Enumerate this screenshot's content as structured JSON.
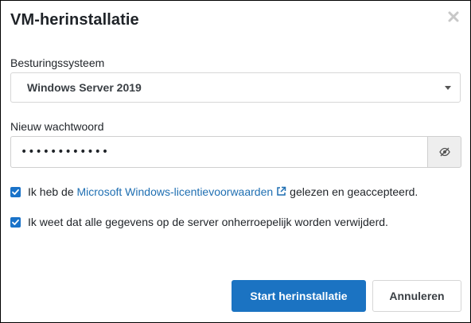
{
  "dialog": {
    "title": "VM-herinstallatie",
    "close_icon": "close-icon"
  },
  "os_field": {
    "label": "Besturingssysteem",
    "selected": "Windows Server 2019",
    "caret_icon": "caret-down-icon"
  },
  "password_field": {
    "label": "Nieuw wachtwoord",
    "value": "••••••••••••",
    "toggle_icon": "eye-slash-icon"
  },
  "checkboxes": [
    {
      "checked": true,
      "text_before": "Ik heb de ",
      "link_text": "Microsoft Windows-licentievoorwaarden",
      "link_icon": "external-link-icon",
      "text_after": "gelezen en geaccepteerd."
    },
    {
      "checked": true,
      "text": "Ik weet dat alle gegevens op de server onherroepelijk worden verwijderd."
    }
  ],
  "buttons": {
    "primary": "Start herinstallatie",
    "secondary": "Annuleren"
  },
  "colors": {
    "primary": "#1b73c2",
    "link": "#1f6fb2",
    "checkbox": "#1a73c9"
  }
}
